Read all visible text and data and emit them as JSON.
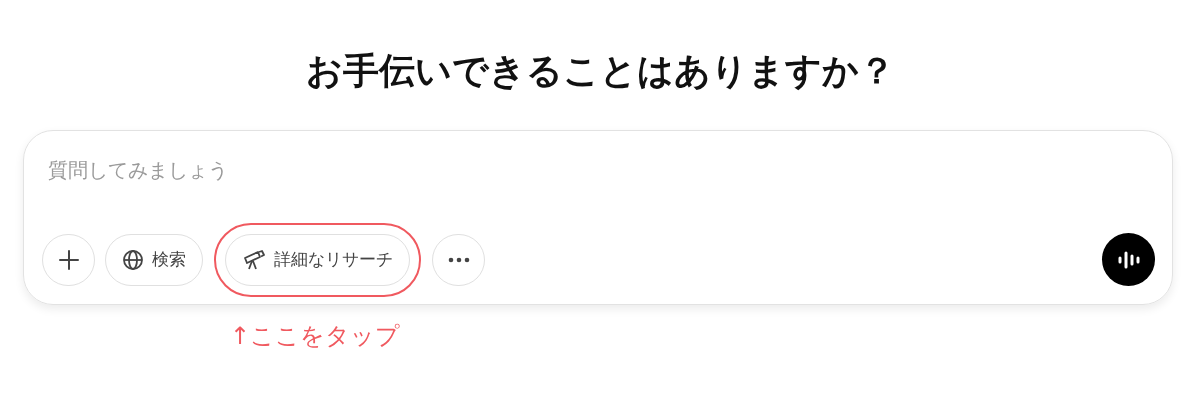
{
  "heading": "お手伝いできることはありますか？",
  "composer": {
    "placeholder": "質問してみましょう",
    "tools": [
      {
        "kind": "add",
        "highlighted": false
      },
      {
        "kind": "search",
        "label": "検索",
        "highlighted": false
      },
      {
        "kind": "research",
        "label": "詳細なリサーチ",
        "highlighted": true
      },
      {
        "kind": "more",
        "highlighted": false
      }
    ]
  },
  "annotation": "↑ここをタップ"
}
